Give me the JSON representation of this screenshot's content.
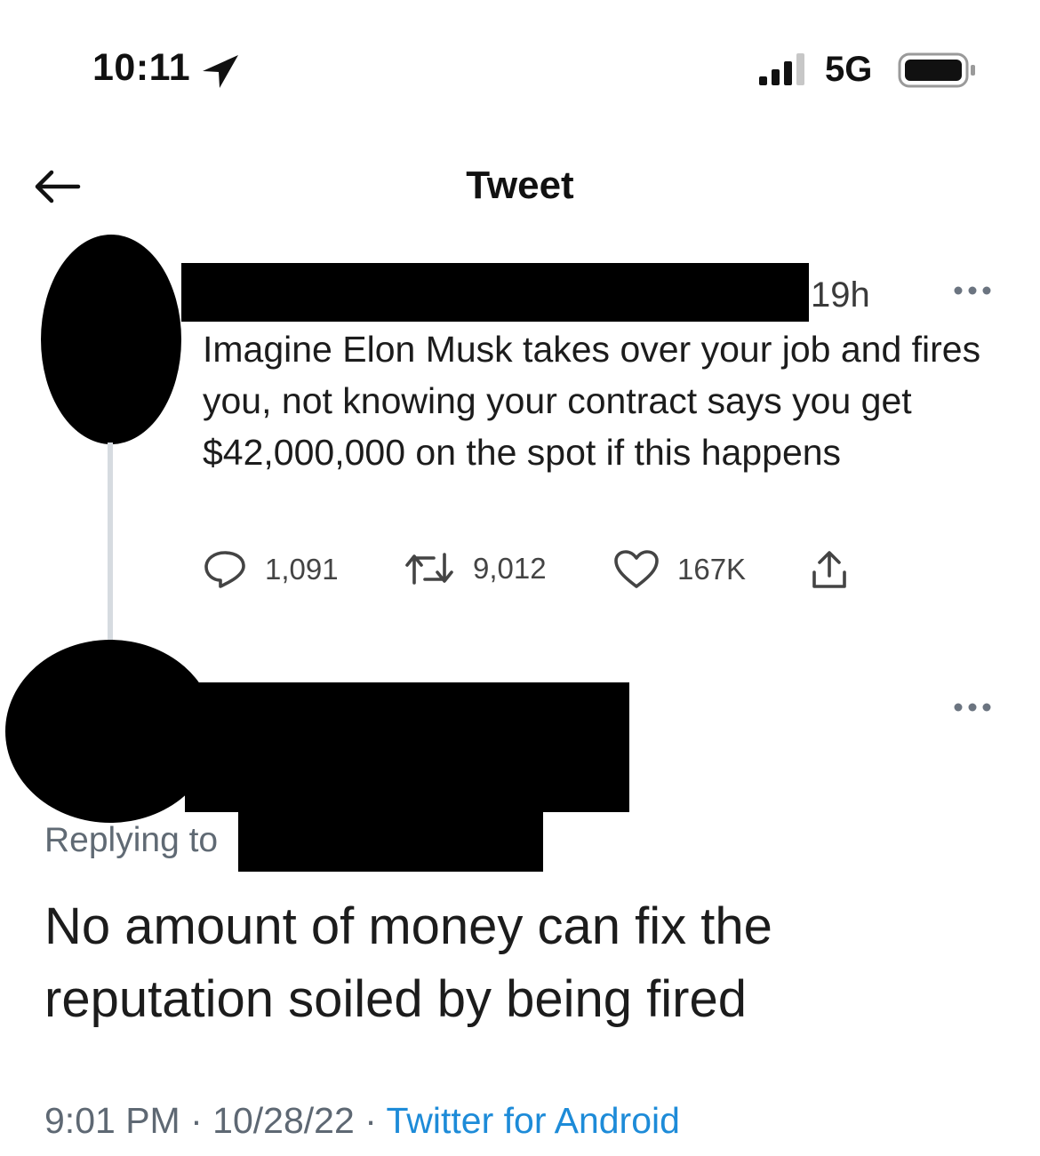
{
  "status_bar": {
    "time": "10:11",
    "network": "5G",
    "icons": [
      "location-arrow-icon",
      "signal-icon",
      "battery-icon"
    ]
  },
  "header": {
    "title": "Tweet",
    "back_icon": "back-arrow-icon"
  },
  "tweet": {
    "time_ago": "19h",
    "text": "Imagine Elon Musk takes over your job and fires you, not knowing your contract says you get $42,000,000 on the spot if this happens",
    "stats": {
      "replies": "1,091",
      "retweets": "9,012",
      "likes": "167K"
    }
  },
  "reply": {
    "replying_to_label": "Replying to",
    "text": "No amount of money can fix the reputation soiled by being fired",
    "time": "9:01 PM",
    "date": "10/28/22",
    "source": "Twitter for Android",
    "separator": "·"
  },
  "colors": {
    "text": "#1c1c1c",
    "muted": "#606a74",
    "link": "#1d8bd8",
    "thread_line": "#d6dbe0"
  }
}
